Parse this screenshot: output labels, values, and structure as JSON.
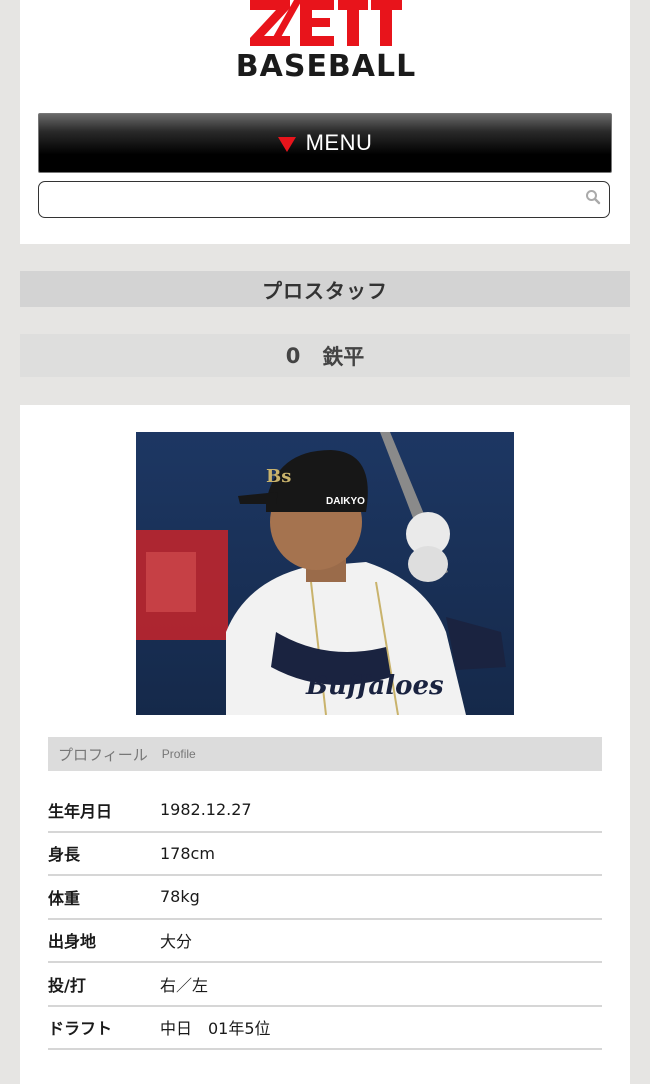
{
  "brand": {
    "logo_text": "ZETT",
    "logo_subtext": "BASEBALL",
    "accent_color": "#e8141b"
  },
  "menu": {
    "label": "MENU",
    "icon": "triangle-down-icon"
  },
  "search": {
    "value": "",
    "placeholder": "",
    "icon": "search-icon"
  },
  "section": {
    "title": "プロスタッフ"
  },
  "player": {
    "number": "0",
    "name": "鉄平"
  },
  "profile": {
    "heading_jp": "プロフィール",
    "heading_en": "Profile",
    "rows": [
      {
        "label": "生年月日",
        "value": "1982.12.27"
      },
      {
        "label": "身長",
        "value": "178cm"
      },
      {
        "label": "体重",
        "value": "78kg"
      },
      {
        "label": "出身地",
        "value": "大分"
      },
      {
        "label": "投/打",
        "value": "右／左"
      },
      {
        "label": "ドラフト",
        "value": "中日　01年5位"
      }
    ]
  }
}
